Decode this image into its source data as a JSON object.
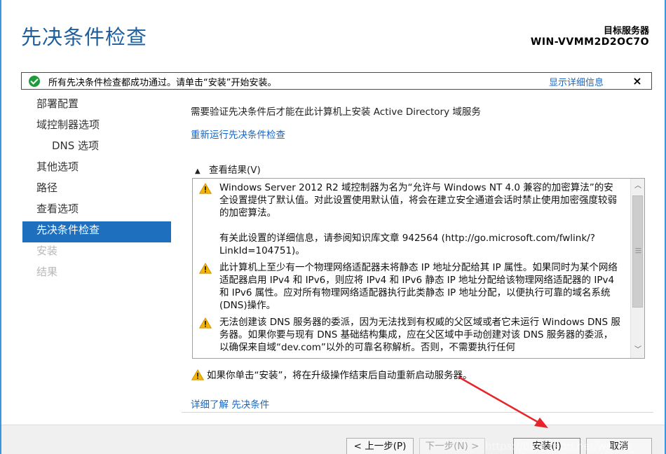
{
  "header": {
    "title": "先决条件检查",
    "target_label": "目标服务器",
    "target_name": "WIN-VVMM2D2OC7O"
  },
  "notification": {
    "text": "所有先决条件检查都成功通过。请单击“安装”开始安装。",
    "details_link": "显示详细信息",
    "close": "×",
    "icon": "success-check-icon",
    "icon_color": "#1f9b3c"
  },
  "nav": {
    "items": [
      {
        "label": "部署配置",
        "state": "normal"
      },
      {
        "label": "域控制器选项",
        "state": "normal"
      },
      {
        "label": "DNS 选项",
        "state": "normal"
      },
      {
        "label": "其他选项",
        "state": "normal"
      },
      {
        "label": "路径",
        "state": "normal"
      },
      {
        "label": "查看选项",
        "state": "normal"
      },
      {
        "label": "先决条件检查",
        "state": "active"
      },
      {
        "label": "安装",
        "state": "disabled"
      },
      {
        "label": "结果",
        "state": "disabled"
      }
    ],
    "active_color": "#1f6fbf"
  },
  "content": {
    "description": "需要验证先决条件后才能在此计算机上安装 Active Directory 域服务",
    "rerun_link": "重新运行先决条件检查",
    "view_results": "查看结果(V)",
    "results": [
      {
        "icon": "warning-icon",
        "paragraphs": [
          "Windows Server 2012 R2 域控制器为名为“允许与 Windows NT 4.0 兼容的加密算法”的安全设置提供了默认值。对此设置使用默认值，将会在建立安全通道会话时禁止使用加密强度较弱的加密算法。",
          "有关此设置的详细信息，请参阅知识库文章 942564 (http://go.microsoft.com/fwlink/?LinkId=104751)。"
        ]
      },
      {
        "icon": "warning-icon",
        "paragraphs": [
          "此计算机上至少有一个物理网络适配器未将静态 IP 地址分配给其 IP 属性。如果同时为某个网络适配器启用 IPv4 和 IPv6，则应将 IPv4 和 IPv6 静态 IP 地址分配给该物理网络适配器的 IPv4 和 IPv6 属性。应对所有物理网络适配器执行此类静态 IP 地址分配，以便执行可靠的域名系统(DNS)操作。"
        ]
      },
      {
        "icon": "warning-icon",
        "paragraphs": [
          "无法创建该 DNS 服务器的委派，因为无法找到有权威的父区域或者它未运行 Windows DNS 服务器。如果你要与现有 DNS 基础结构集成，应在父区域中手动创建对该 DNS 服务器的委派，以确保来自域“dev.com”以外的可靠名称解析。否则，不需要执行任何"
        ]
      }
    ],
    "restart_warning": "如果你单击“安装”，将在升级操作结束后自动重新启动服务器。",
    "more_info_link": "详细了解 先决条件"
  },
  "footer": {
    "prev": "< 上一步(P)",
    "next": "下一步(N) >",
    "install": "安装(I)",
    "cancel": "取消"
  },
  "watermark": "https://blog.csdn.net/wei_ta_",
  "colors": {
    "title": "#1f5f9e",
    "link": "#1a66c2",
    "warning": "#f5b400",
    "arrow": "#e8242b"
  }
}
